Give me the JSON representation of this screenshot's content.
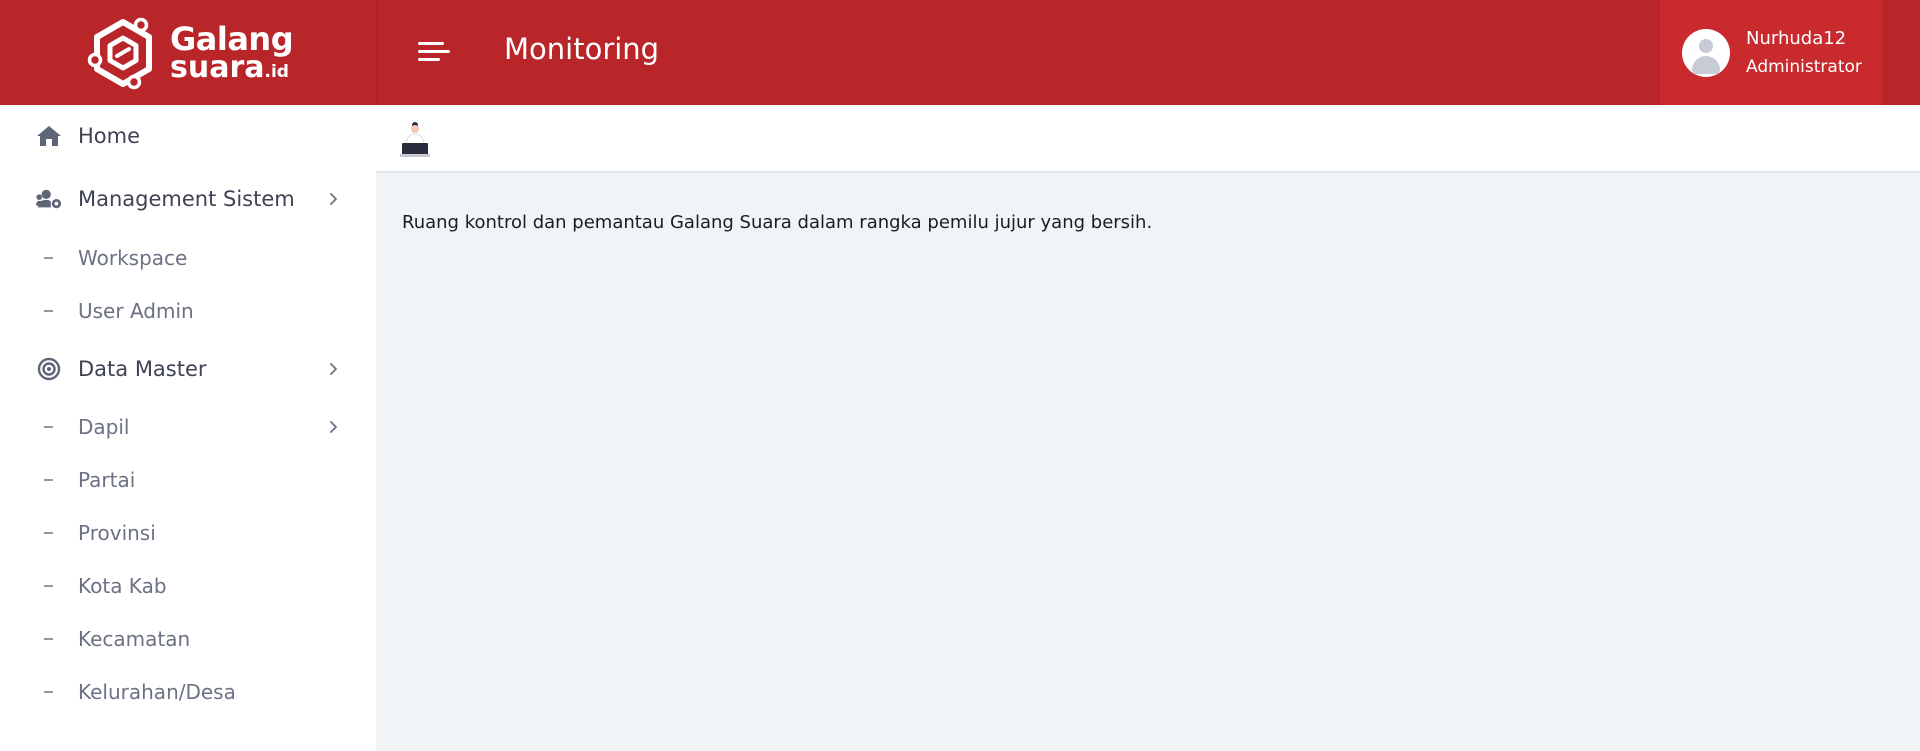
{
  "brand": {
    "name_line1": "Galang",
    "name_line2": "suara",
    "name_suffix": ".id"
  },
  "header": {
    "title": "Monitoring",
    "menu_toggle_icon": "hamburger-menu-icon"
  },
  "user": {
    "name": "Nurhuda12",
    "role": "Administrator",
    "avatar_icon": "user-avatar-icon"
  },
  "sidebar": {
    "items": [
      {
        "label": "Home",
        "icon": "home-icon"
      },
      {
        "label": "Management Sistem",
        "icon": "users-cog-icon",
        "has_submenu": true
      },
      {
        "label": "Workspace",
        "sub": true
      },
      {
        "label": "User Admin",
        "sub": true
      },
      {
        "label": "Data Master",
        "icon": "target-icon",
        "has_submenu": true
      },
      {
        "label": "Dapil",
        "sub": true,
        "has_submenu": true
      },
      {
        "label": "Partai",
        "sub": true
      },
      {
        "label": "Provinsi",
        "sub": true
      },
      {
        "label": "Kota Kab",
        "sub": true
      },
      {
        "label": "Kecamatan",
        "sub": true
      },
      {
        "label": "Kelurahan/Desa",
        "sub": true
      }
    ]
  },
  "content": {
    "description": "Ruang kontrol dan pemantau Galang Suara dalam rangka pemilu jujur yang bersih."
  },
  "colors": {
    "header_bg": "#b9262a",
    "user_box_bg": "#c92a2d",
    "content_bg": "#f0f4f7"
  }
}
